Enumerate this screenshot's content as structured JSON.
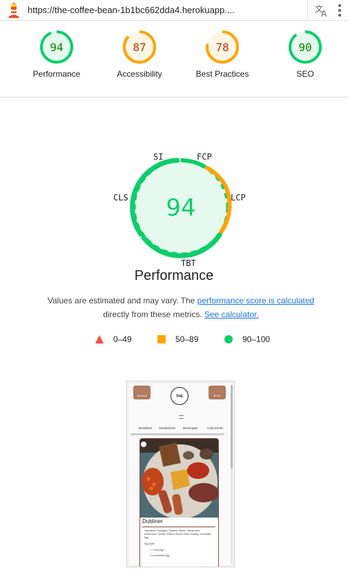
{
  "browser": {
    "url": "https://the-coffee-bean-1b1bc662dda4.herokuapp...."
  },
  "summary": [
    {
      "score": "94",
      "label": "Performance",
      "status": "pass",
      "fraction": 0.94
    },
    {
      "score": "87",
      "label": "Accessibility",
      "status": "average",
      "fraction": 0.87
    },
    {
      "score": "78",
      "label": "Best Practices",
      "status": "average",
      "fraction": 0.78
    },
    {
      "score": "90",
      "label": "SEO",
      "status": "pass",
      "fraction": 0.9
    }
  ],
  "colors": {
    "pass": "#0cce6b",
    "pass_text": "#008800",
    "pass_bg": "#e6f9ee",
    "average": "#ffa400",
    "average_text": "#c33300",
    "average_bg": "#fff6e6",
    "fail": "#ff4e42",
    "link": "#1a73e8"
  },
  "performance": {
    "score": "94",
    "title": "Performance",
    "metrics": {
      "si": "SI",
      "fcp": "FCP",
      "lcp": "LCP",
      "tbt": "TBT",
      "cls": "CLS"
    },
    "description_1": "Values are estimated and may vary. The ",
    "link_calc": "performance score is calculated",
    "description_2": " directly from these metrics. ",
    "link_calculator": "See calculator."
  },
  "legend": [
    {
      "shape": "triangle",
      "range": "0–49"
    },
    {
      "shape": "square",
      "range": "50–89"
    },
    {
      "shape": "circle",
      "range": "90–100"
    }
  ],
  "thumbnail": {
    "account": "Account",
    "basket": "£0.00",
    "logo": "THE",
    "nav": [
      "Breakfast",
      "Sandwiches",
      "Beverages",
      "Cold Drinks"
    ],
    "card_title": "Dubliner",
    "ingredients": "Ingredients: Sausages, Rashers, Beans, Hashbrowns, Mushrooms, Tomato, White or Brown Toast, Pudding, Scrambled Egg",
    "egg_style": "Egg Style:",
    "egg_1": "Fried Egg",
    "egg_2": "Scrambled Egg"
  }
}
